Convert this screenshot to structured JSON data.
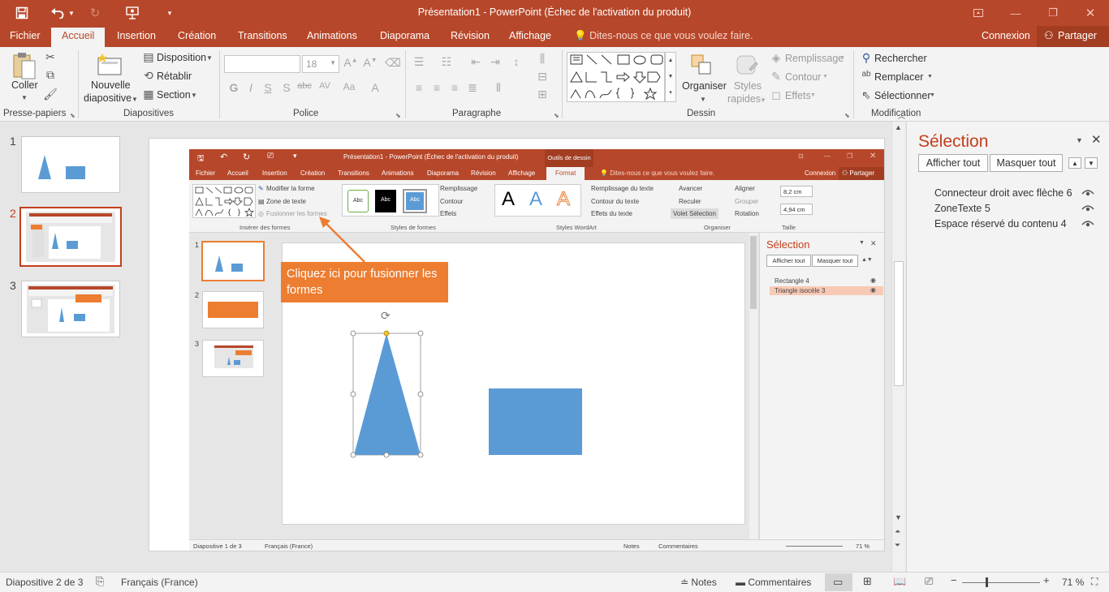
{
  "titlebar": {
    "title": "Présentation1 - PowerPoint (Échec de l'activation du produit)"
  },
  "tabs": {
    "file": "Fichier",
    "items": [
      "Accueil",
      "Insertion",
      "Création",
      "Transitions",
      "Animations",
      "Diaporama",
      "Révision",
      "Affichage"
    ],
    "tell_me": "Dites-nous ce que vous voulez faire.",
    "connexion": "Connexion",
    "partager": "Partager"
  },
  "ribbon": {
    "clipboard": {
      "paste": "Coller",
      "label": "Presse-papiers"
    },
    "slides": {
      "new_slide_1": "Nouvelle",
      "new_slide_2": "diapositive",
      "disposition": "Disposition",
      "retablir": "Rétablir",
      "section": "Section",
      "label": "Diapositives"
    },
    "font": {
      "size": "18",
      "label": "Police"
    },
    "paragraph": {
      "label": "Paragraphe"
    },
    "drawing": {
      "organiser": "Organiser",
      "styles_1": "Styles",
      "styles_2": "rapides",
      "remplissage": "Remplissage",
      "contour": "Contour",
      "effets": "Effets",
      "label": "Dessin"
    },
    "editing": {
      "rechercher": "Rechercher",
      "remplacer": "Remplacer",
      "selectionner": "Sélectionner",
      "label": "Modification"
    }
  },
  "thumbnails": {
    "numbers": [
      "1",
      "2",
      "3"
    ]
  },
  "inner": {
    "title": "Présentation1 - PowerPoint (Échec de l'activation du produit)",
    "context_tab": "Outils de dessin",
    "tabs": [
      "Fichier",
      "Accueil",
      "Insertion",
      "Création",
      "Transitions",
      "Animations",
      "Diaporama",
      "Révision",
      "Affichage"
    ],
    "format_tab": "Format",
    "tell_me": "Dites-nous ce que vous voulez faire.",
    "connexion": "Connexion",
    "partager": "Partager",
    "ribbon": {
      "modifier_forme": "Modifier la forme",
      "zone_texte": "Zone de texte",
      "fusionner": "Fusionner les formes",
      "inserer_formes": "Insérer des formes",
      "abc": "Abc",
      "remplissage": "Remplissage",
      "contour": "Contour",
      "effets": "Effets",
      "styles_formes": "Styles de formes",
      "remplissage_texte": "Remplissage du texte",
      "contour_texte": "Contour du texte",
      "effets_texte": "Effets du texte",
      "styles_wordart": "Styles WordArt",
      "wa": "A",
      "avancer": "Avancer",
      "reculer": "Reculer",
      "volet": "Volet Sélection",
      "aligner": "Aligner",
      "grouper": "Grouper",
      "rotation": "Rotation",
      "organiser": "Organiser",
      "height": "8,2 cm",
      "width": "4,94 cm",
      "taille": "Taille"
    },
    "thumb_numbers": [
      "1",
      "2",
      "3"
    ],
    "selection_pane": {
      "title": "Sélection",
      "show_all": "Afficher tout",
      "hide_all": "Masquer tout",
      "items": [
        "Rectangle 4",
        "Triangle isocèle 3"
      ]
    },
    "status": {
      "slide": "Diapositive 1 de 3",
      "lang": "Français (France)",
      "notes": "Notes",
      "comments": "Commentaires",
      "zoom": "71 %"
    },
    "callout": "Cliquez ici pour fusionner les formes"
  },
  "selection_pane": {
    "title": "Sélection",
    "show_all": "Afficher tout",
    "hide_all": "Masquer tout",
    "items": [
      "Connecteur droit avec flèche 6",
      "ZoneTexte 5",
      "Espace réservé du contenu 4"
    ]
  },
  "statusbar": {
    "slide": "Diapositive 2 de 3",
    "lang": "Français (France)",
    "notes": "Notes",
    "comments": "Commentaires",
    "zoom": "71 %"
  },
  "colors": {
    "accent": "#b7472a",
    "shape_blue": "#5b9bd5",
    "callout_orange": "#ed7d31"
  }
}
